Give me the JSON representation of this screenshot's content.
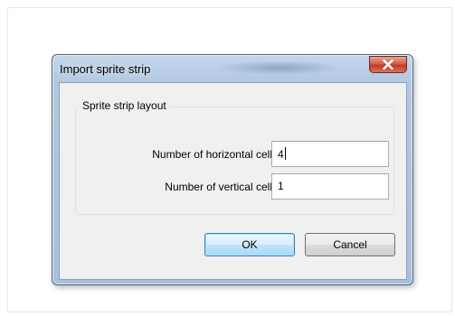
{
  "dialog": {
    "title": "Import sprite strip",
    "close_icon": "close-icon",
    "group_label": "Sprite strip layout",
    "fields": {
      "horizontal": {
        "label": "Number of horizontal cells",
        "value": "4"
      },
      "vertical": {
        "label": "Number of vertical cells",
        "value": "1"
      }
    },
    "buttons": {
      "ok": "OK",
      "cancel": "Cancel"
    }
  },
  "colors": {
    "close_button": "#c0392b",
    "default_button_border": "#3c7fb1",
    "window_frame": "#a9c0dc"
  }
}
